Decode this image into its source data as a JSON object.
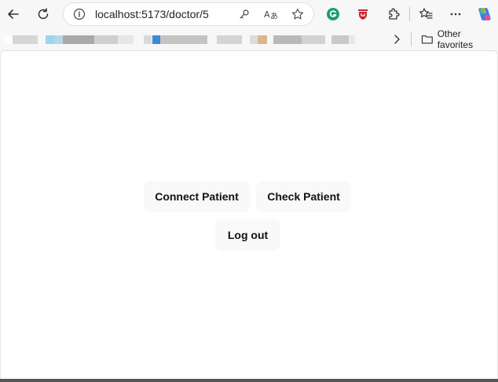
{
  "browser": {
    "url": "localhost:5173/doctor/5",
    "other_favorites_label": "Other favorites"
  },
  "page": {
    "buttons": {
      "connect_patient": "Connect Patient",
      "check_patient": "Check Patient",
      "log_out": "Log out"
    }
  }
}
